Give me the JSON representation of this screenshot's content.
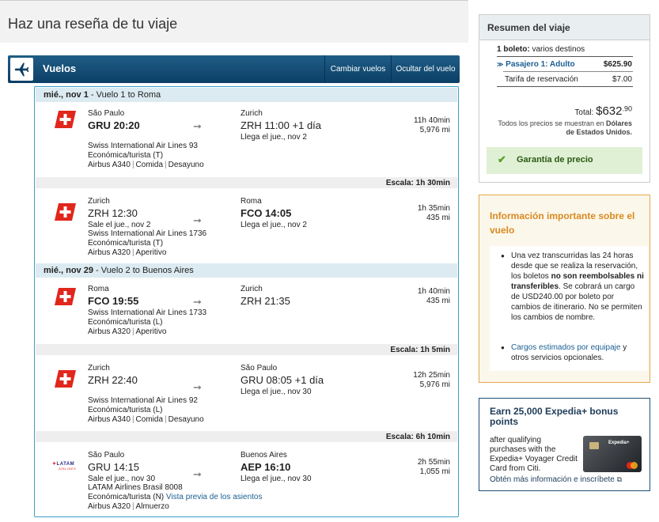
{
  "page": {
    "title": "Haz una reseña de tu viaje"
  },
  "bar": {
    "title": "Vuelos",
    "change_label": "Cambiar vuelos",
    "hide_label": "Ocultar del vuelo"
  },
  "days": [
    {
      "date": "mié., nov 1",
      "desc": " - Vuelo 1 to Roma"
    },
    {
      "date": "mié., nov 29",
      "desc": " - Vuelo 2 to Buenos Aires"
    }
  ],
  "segments": [
    {
      "dep_city": "São Paulo",
      "dep_time": "GRU 20:20",
      "arr_city": "Zurich",
      "arr_time": "ZRH 11:00 +1 día",
      "arr_note": "Llega el jue., nov 2",
      "dep_note": "",
      "airline": "Swiss International Air Lines 93",
      "cabin": "Económica/turista (T)",
      "aircraft": "Airbus A340",
      "extras": [
        "Comida",
        "Desayuno"
      ],
      "duration": "11h 40min",
      "distance": "5,976 mi"
    },
    {
      "dep_city": "Zurich",
      "dep_time": "ZRH 12:30",
      "arr_city": "Roma",
      "arr_time": "FCO 14:05",
      "arr_note": "Llega el jue., nov 2",
      "dep_note": "Sale el jue., nov 2",
      "airline": "Swiss International Air Lines 1736",
      "cabin": "Económica/turista (T)",
      "aircraft": "Airbus A320",
      "extras": [
        "Aperitivo"
      ],
      "duration": "1h 35min",
      "distance": "435 mi"
    },
    {
      "dep_city": "Roma",
      "dep_time": "FCO 19:55",
      "arr_city": "Zurich",
      "arr_time": "ZRH 21:35",
      "arr_note": "",
      "dep_note": "",
      "airline": "Swiss International Air Lines 1733",
      "cabin": "Económica/turista (L)",
      "aircraft": "Airbus A320",
      "extras": [
        "Aperitivo"
      ],
      "duration": "1h 40min",
      "distance": "435 mi"
    },
    {
      "dep_city": "Zurich",
      "dep_time": "ZRH 22:40",
      "arr_city": "São Paulo",
      "arr_time": "GRU 08:05 +1 día",
      "arr_note": "Llega el jue., nov 30",
      "dep_note": "",
      "airline": "Swiss International Air Lines 92",
      "cabin": "Económica/turista (L)",
      "aircraft": "Airbus A340",
      "extras": [
        "Comida",
        "Desayuno"
      ],
      "duration": "12h 25min",
      "distance": "5,976 mi"
    },
    {
      "dep_city": "São Paulo",
      "dep_time": "GRU 14:15",
      "arr_city": "Buenos Aires",
      "arr_time": "AEP 16:10",
      "arr_note": "Llega el jue., nov 30",
      "dep_note": "Sale el jue., nov 30",
      "airline": "LATAM Airlines Brasil 8008",
      "cabin": "Económica/turista (N)",
      "seat_link": "Vista previa de los asientos",
      "aircraft": "Airbus A320",
      "extras": [
        "Almuerzo"
      ],
      "duration": "2h 55min",
      "distance": "1,055 mi"
    }
  ],
  "layovers": [
    "Escala: 1h 30min",
    "Escala: 1h 5min",
    "Escala: 6h 10min"
  ],
  "latam_logo": {
    "brand": "LATAM",
    "sub": "AIRLINES"
  },
  "summary": {
    "title": "Resumen del viaje",
    "tickets_bold": "1 boleto:",
    "tickets_rest": " varios destinos",
    "passenger_label": "Pasajero 1: Adulto",
    "passenger_price": "$625.90",
    "fee_label": "Tarifa de reservación",
    "fee_price": "$7.00",
    "total_label": "Total:",
    "total_main": "$632",
    "total_cents": ".90",
    "currency_note_1": "Todos los precios se muestran en ",
    "currency_note_bold": "Dólares de Estados Unidos.",
    "guarantee": "Garantía de precio"
  },
  "info": {
    "title": "Información importante sobre el vuelo",
    "p1_a": "Una vez transcurridas las 24 horas desde que se realiza la reservación, los boletos ",
    "p1_bold": "no son reembolsables ni transferibles",
    "p1_b": ". Se cobrará un cargo de USD240.00 por boleto por cambios de itinerario. No se permiten los cambios de nombre.",
    "p2_link": "Cargos estimados por equipaje",
    "p2_rest": " y otros servicios opcionales."
  },
  "promo": {
    "title": "Earn 25,000 Expedia+ bonus points",
    "text": "after qualifying purchases with the Expedia+ Voyager Credit Card from Citi.",
    "link": "Obtén más información e inscríbete",
    "card_brand": "Expedia+"
  },
  "colors": {
    "bar": "#0b3f66",
    "swiss_red": "#e1261c",
    "border_blue": "#3a9fc4",
    "info_orange": "#d98a22",
    "guarantee_green": "#e0f0d5"
  }
}
